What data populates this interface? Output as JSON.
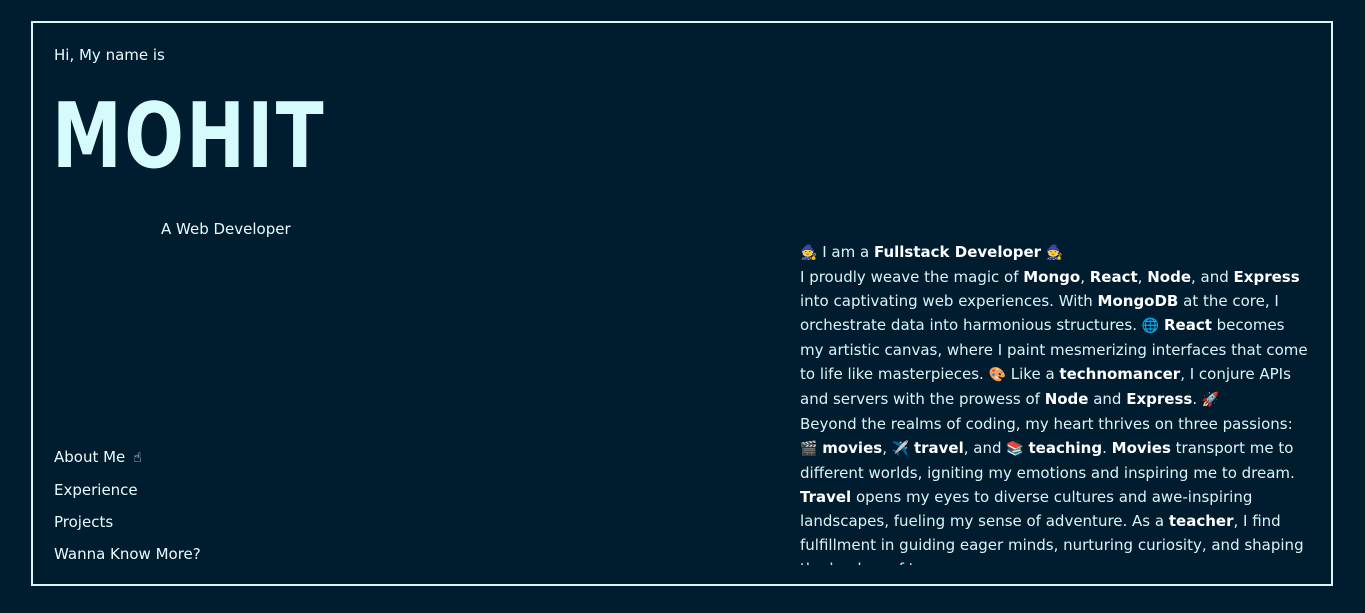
{
  "hero": {
    "greeting": "Hi, My name is",
    "name": "MOHIT",
    "role": "A Web Developer"
  },
  "nav": {
    "items": [
      {
        "label": "About Me",
        "icon": "☝"
      },
      {
        "label": "Experience"
      },
      {
        "label": "Projects"
      },
      {
        "label": "Wanna Know More?"
      }
    ]
  },
  "about": {
    "heading": {
      "emoji_left": "🧙",
      "pre": "I am a",
      "strong": "Fullstack Developer",
      "emoji_right": "🧙"
    },
    "p1": {
      "t1": "I proudly weave the magic of ",
      "b1": "Mongo",
      "t2": ", ",
      "b2": "React",
      "t3": ", ",
      "b3": "Node",
      "t4": ", and ",
      "b4": "Express",
      "t5": " into captivating web experiences. With ",
      "b5": "MongoDB",
      "t6": " at the core, I orchestrate data into harmonious structures. ",
      "e1": "🌐",
      "t7": " ",
      "b6": "React",
      "t8": " becomes my artistic canvas, where I paint mesmerizing interfaces that come to life like masterpieces. ",
      "e2": "🎨",
      "t9": " Like a ",
      "b7": "technomancer",
      "t10": ", I conjure APIs and servers with the prowess of ",
      "b8": "Node",
      "t11": " and ",
      "b9": "Express",
      "t12": ". ",
      "e3": "🚀"
    },
    "p2": {
      "t1": "Beyond the realms of coding, my heart thrives on three passions: ",
      "e1": "🎬",
      "t2": " ",
      "b1": "movies",
      "t3": ", ",
      "e2": "✈️",
      "t4": " ",
      "b2": "travel",
      "t5": ", and ",
      "e3": "📚",
      "t6": " ",
      "b3": "teaching",
      "t7": ". ",
      "b4": "Movies",
      "t8": " transport me to different worlds, igniting my emotions and inspiring me to dream. ",
      "b5": "Travel",
      "t9": " opens my eyes to diverse cultures and awe-inspiring landscapes, fueling my sense of adventure. As a ",
      "b6": "teacher",
      "t10": ", I find fulfillment in guiding eager minds, nurturing curiosity, and shaping the leaders of tomorrow."
    }
  },
  "colors": {
    "background": "#001c2f",
    "border": "#dff4f8",
    "name": "#d6fbfd",
    "text": "#e9fbff"
  }
}
